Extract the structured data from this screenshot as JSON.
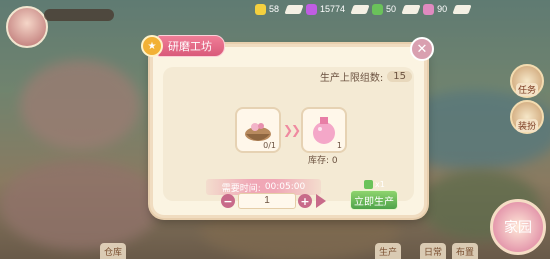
{
  "top_bar": {
    "resources": [
      {
        "icon": "energy-icon",
        "value": "58",
        "color": "#f4d03f"
      },
      {
        "icon": "gem-icon",
        "value": "15774",
        "color": "#c05de3"
      },
      {
        "icon": "leaf-icon",
        "value": "50",
        "color": "#6ac25a"
      },
      {
        "icon": "ticket-icon",
        "value": "90",
        "color": "#e08ac0"
      }
    ]
  },
  "dialog": {
    "title": "研磨工坊",
    "limit_label": "生产上限组数:",
    "limit_value": "15",
    "input_item": {
      "icon": "basket-icon",
      "count": "0/1"
    },
    "output_item": {
      "icon": "pink-potion-icon",
      "count": "1"
    },
    "stock_label": "库存: 0",
    "time_label": "需要时间:",
    "time_value": "00:05:00",
    "quantity": "1",
    "cost": "x1",
    "produce_button": "立即生产"
  },
  "bottom_menu": [
    "仓库",
    "生产",
    "日常",
    "布置"
  ],
  "side_menu": [
    "任务",
    "装扮"
  ],
  "home_button": "家园"
}
